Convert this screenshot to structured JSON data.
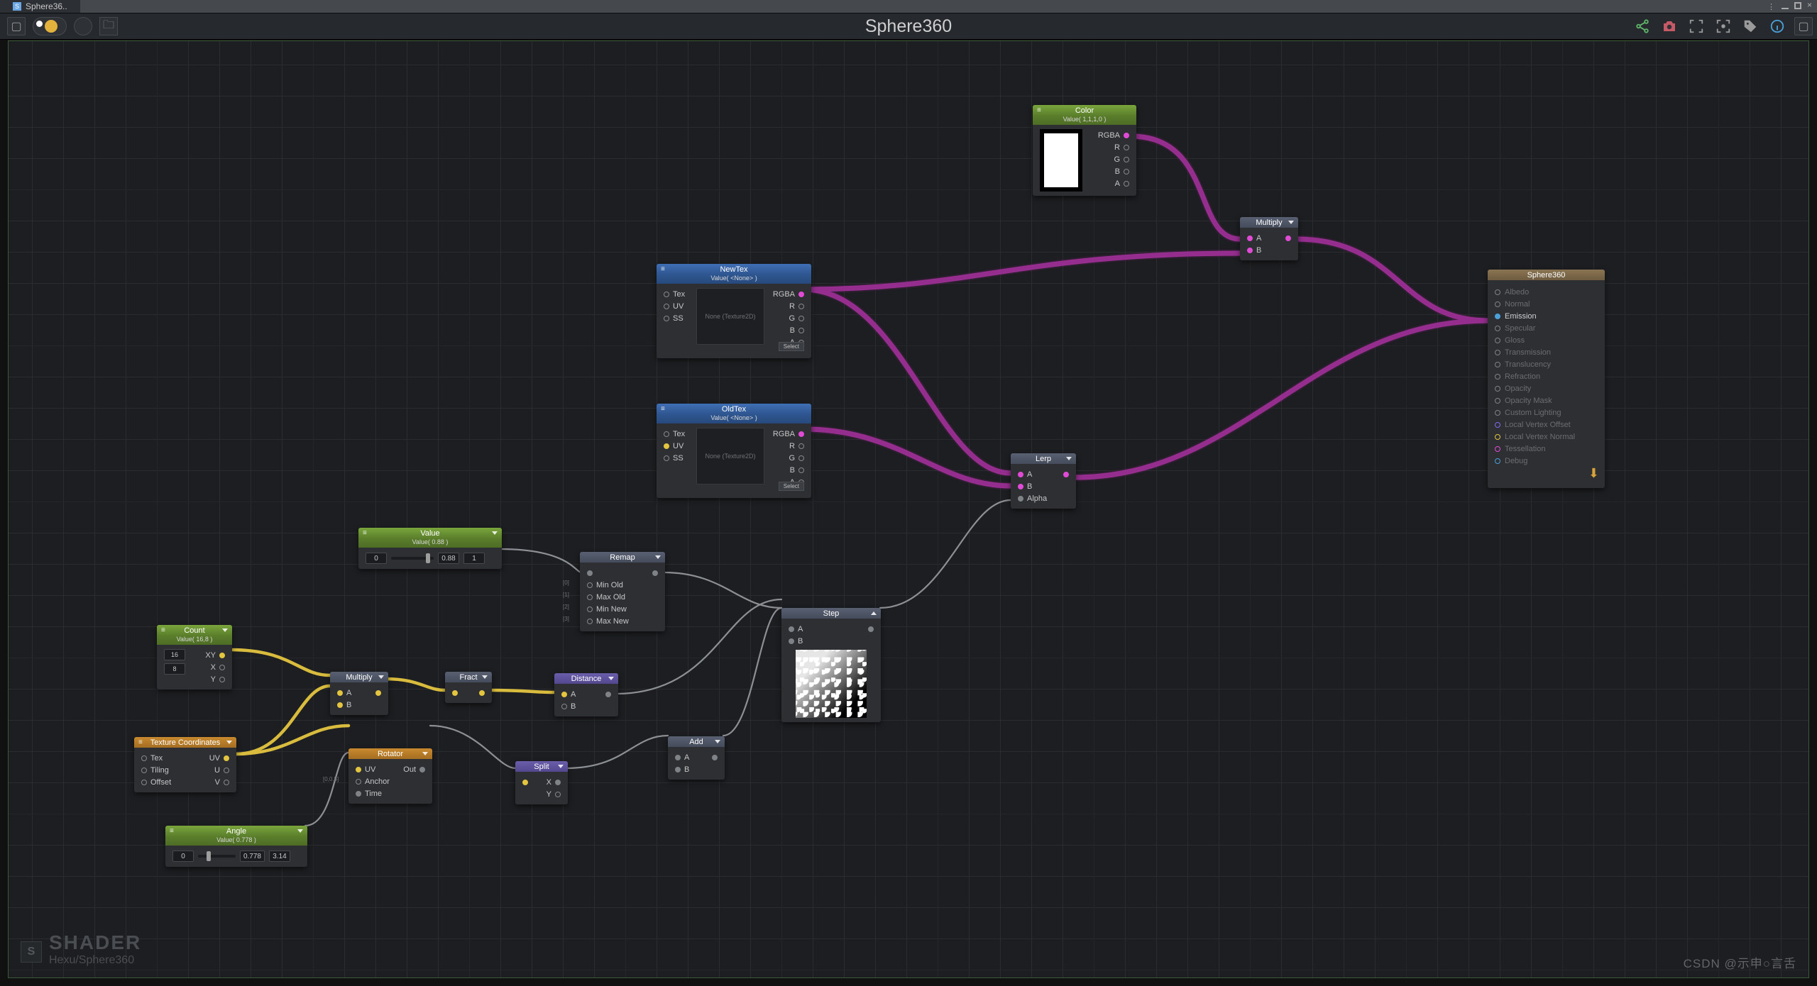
{
  "window": {
    "tab_title": "Sphere36..",
    "tab_letter": "S"
  },
  "toolbar": {
    "title": "Sphere360"
  },
  "watermark": {
    "big": "SHADER",
    "small": "Hexu/Sphere360",
    "icon_letter": "S"
  },
  "csdn": "CSDN @示申○言舌",
  "nodes": {
    "color": {
      "title": "Color",
      "sub": "Value( 1,1,1,0 )",
      "outs": [
        "RGBA",
        "R",
        "G",
        "B",
        "A"
      ]
    },
    "newtex": {
      "title": "NewTex",
      "sub": "Value( <None> )",
      "ins": [
        "Tex",
        "UV",
        "SS"
      ],
      "outs": [
        "RGBA",
        "R",
        "G",
        "B",
        "A"
      ],
      "preview": "None (Texture2D)",
      "select": "Select"
    },
    "oldtex": {
      "title": "OldTex",
      "sub": "Value( <None> )",
      "ins": [
        "Tex",
        "UV",
        "SS"
      ],
      "outs": [
        "RGBA",
        "R",
        "G",
        "B",
        "A"
      ],
      "preview": "None (Texture2D)",
      "select": "Select"
    },
    "multiplyTop": {
      "title": "Multiply",
      "ins": [
        "A",
        "B"
      ]
    },
    "lerp": {
      "title": "Lerp",
      "ins": [
        "A",
        "B",
        "Alpha"
      ]
    },
    "value": {
      "title": "Value",
      "sub": "Value( 0.88 )",
      "slider_left": "0",
      "slider_val": "0.88",
      "slider_right": "1"
    },
    "count": {
      "title": "Count",
      "sub": "Value( 16,8 )",
      "outs": [
        "XY",
        "X",
        "Y"
      ],
      "x": "16",
      "y": "8"
    },
    "multiply": {
      "title": "Multiply",
      "ins": [
        "A",
        "B"
      ]
    },
    "fract": {
      "title": "Fract"
    },
    "distance": {
      "title": "Distance",
      "ins": [
        "A",
        "B"
      ]
    },
    "remap": {
      "title": "Remap",
      "ins": [
        "",
        "Min Old",
        "Max Old",
        "Min New",
        "Max New"
      ],
      "side": [
        "[0]",
        "[1]",
        "[2]",
        "[3]"
      ]
    },
    "step": {
      "title": "Step",
      "ins": [
        "A",
        "B"
      ]
    },
    "add": {
      "title": "Add",
      "ins": [
        "A",
        "B"
      ]
    },
    "split": {
      "title": "Split",
      "outs": [
        "X",
        "Y"
      ]
    },
    "rotator": {
      "title": "Rotator",
      "ins": [
        "UV",
        "Anchor",
        "Time"
      ],
      "out": "Out",
      "side": "[0,0.5]"
    },
    "texcoord": {
      "title": "Texture Coordinates",
      "ins": [
        "Tex",
        "Tiling",
        "Offset"
      ],
      "outs": [
        "UV",
        "U",
        "V"
      ]
    },
    "angle": {
      "title": "Angle",
      "sub": "Value( 0.778 )",
      "slider_left": "0",
      "slider_val": "0.778",
      "slider_right": "3.14"
    },
    "master": {
      "title": "Sphere360",
      "rows": [
        {
          "label": "Albedo",
          "color": "#7f8286"
        },
        {
          "label": "Normal",
          "color": "#7f8286"
        },
        {
          "label": "Emission",
          "color": "#4aa0d8",
          "active": true,
          "filled": true
        },
        {
          "label": "Specular",
          "color": "#7f8286"
        },
        {
          "label": "Gloss",
          "color": "#7f8286"
        },
        {
          "label": "Transmission",
          "color": "#7f8286"
        },
        {
          "label": "Translucency",
          "color": "#7f8286"
        },
        {
          "label": "Refraction",
          "color": "#7f8286"
        },
        {
          "label": "Opacity",
          "color": "#7f8286"
        },
        {
          "label": "Opacity Mask",
          "color": "#7f8286"
        },
        {
          "label": "Custom Lighting",
          "color": "#7f8286"
        },
        {
          "label": "Local Vertex Offset",
          "color": "#7d6cf0"
        },
        {
          "label": "Local Vertex Normal",
          "color": "#e4c53f"
        },
        {
          "label": "Tessellation",
          "color": "#e04bd5"
        },
        {
          "label": "Debug",
          "color": "#4aa0d8"
        }
      ]
    }
  }
}
